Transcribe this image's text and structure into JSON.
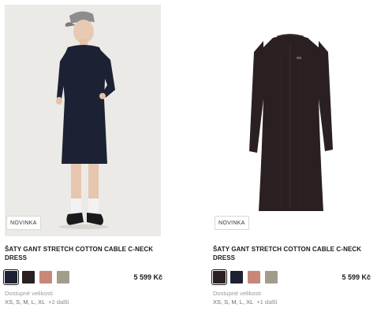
{
  "products": [
    {
      "badge": "NOVINKA",
      "title": "ŠATY GANT STRETCH COTTON CABLE C-NECK DRESS",
      "price": "5 599 Kč",
      "availability_label": "Dostupné velikosti",
      "sizes": "XS, S, M, L, XL",
      "more_sizes": "+2 další",
      "colors": [
        "#1c2233",
        "#2a2022",
        "#c98778",
        "#a39b8b"
      ],
      "selected_color_index": 0
    },
    {
      "badge": "NOVINKA",
      "title": "ŠATY GANT STRETCH COTTON CABLE C-NECK DRESS",
      "price": "5 599 Kč",
      "availability_label": "Dostupné velikosti",
      "sizes": "XS, S, M, L, XL",
      "more_sizes": "+1 další",
      "colors": [
        "#2a2022",
        "#1c2233",
        "#c98778",
        "#a39b8b"
      ],
      "selected_color_index": 0
    }
  ]
}
